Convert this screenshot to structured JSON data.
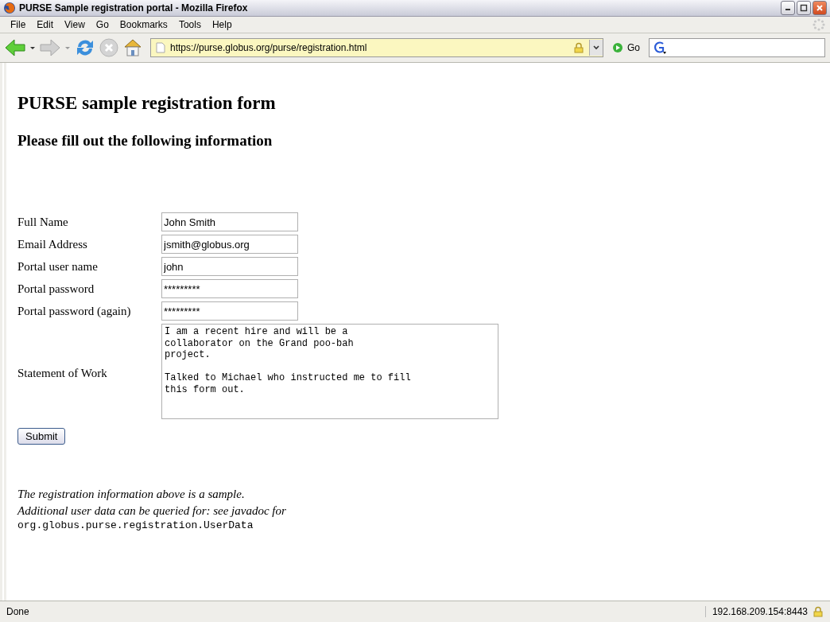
{
  "window": {
    "title": "PURSE Sample registration portal - Mozilla Firefox"
  },
  "menu": [
    "File",
    "Edit",
    "View",
    "Go",
    "Bookmarks",
    "Tools",
    "Help"
  ],
  "address_bar": {
    "url": "https://purse.globus.org/purse/registration.html",
    "secure": true
  },
  "go_button": "Go",
  "page": {
    "heading": "PURSE sample registration form",
    "subheading": "Please fill out the following information",
    "fields": [
      {
        "label": "Full Name",
        "kind": "text",
        "value": "John Smith"
      },
      {
        "label": "Email Address",
        "kind": "text",
        "value": "jsmith@globus.org"
      },
      {
        "label": "Portal user name",
        "kind": "text",
        "value": "john"
      },
      {
        "label": "Portal password",
        "kind": "text",
        "value": "*********"
      },
      {
        "label": "Portal password (again)",
        "kind": "text",
        "value": "*********"
      },
      {
        "label": "Statement of Work",
        "kind": "textarea",
        "value": "I am a recent hire and will be a\ncollaborator on the Grand poo-bah\nproject.\n\nTalked to Michael who instructed me to fill\nthis form out."
      }
    ],
    "submit": "Submit",
    "notes": [
      "The registration information above is a sample.",
      "Additional user data can be queried for: see javadoc for"
    ],
    "class_name": "org.globus.purse.registration.UserData"
  },
  "status_bar": {
    "text": "Done",
    "host": "192.168.209.154:8443"
  }
}
